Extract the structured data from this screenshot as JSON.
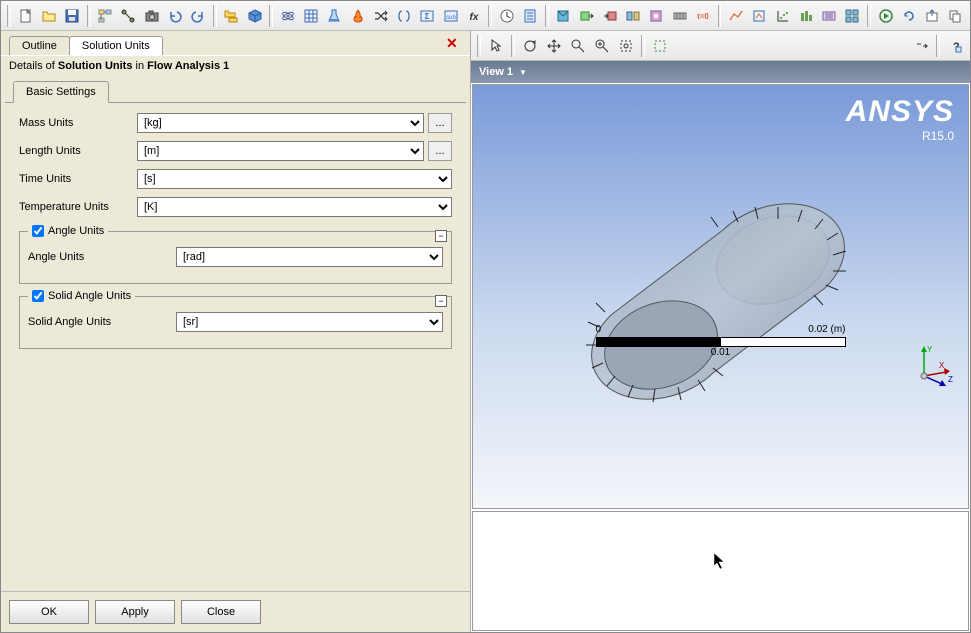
{
  "tabs": {
    "outline": "Outline",
    "solution_units": "Solution Units"
  },
  "details": {
    "prefix": "Details of ",
    "subject": "Solution Units",
    "mid": " in ",
    "container": "Flow Analysis 1"
  },
  "subtab": {
    "basic": "Basic Settings"
  },
  "form": {
    "mass_label": "Mass Units",
    "mass_value": "[kg]",
    "length_label": "Length Units",
    "length_value": "[m]",
    "time_label": "Time Units",
    "time_value": "[s]",
    "temp_label": "Temperature Units",
    "temp_value": "[K]",
    "angle_group": "Angle Units",
    "angle_label": "Angle Units",
    "angle_value": "[rad]",
    "solid_angle_group": "Solid Angle Units",
    "solid_angle_label": "Solid Angle Units",
    "solid_angle_value": "[sr]"
  },
  "buttons": {
    "ok": "OK",
    "apply": "Apply",
    "close": "Close",
    "dots": "..."
  },
  "view": {
    "title": "View 1",
    "dropdown": "▼"
  },
  "brand": {
    "name": "ANSYS",
    "version": "R15.0"
  },
  "scale": {
    "left": "0",
    "right": "0.02",
    "unit": "(m)",
    "mid": "0.01"
  },
  "triad": {
    "x": "X",
    "y": "Y",
    "z": "Z"
  }
}
